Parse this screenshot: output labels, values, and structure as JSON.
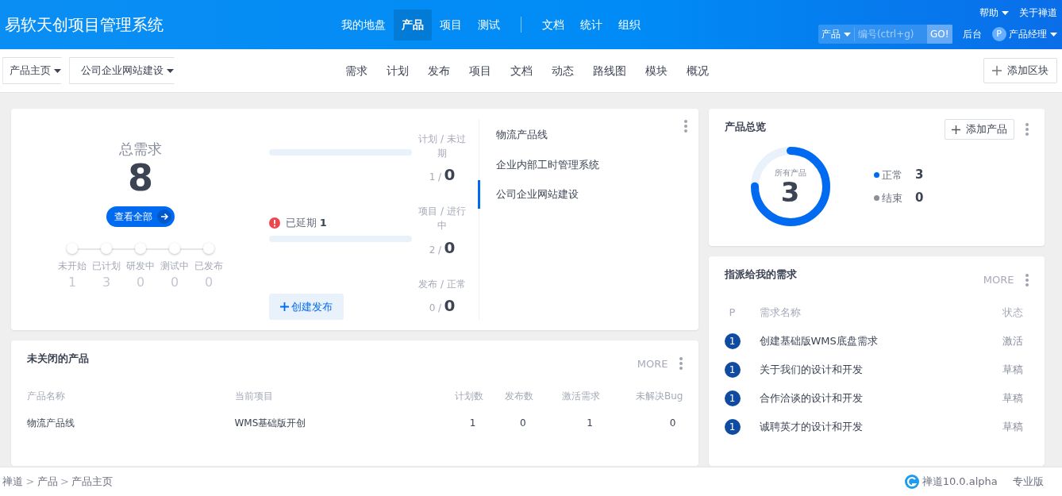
{
  "header": {
    "brand": "易软天创项目管理系统",
    "nav": [
      {
        "label": "我的地盘",
        "selected": false
      },
      {
        "label": "产品",
        "selected": true
      },
      {
        "label": "项目",
        "selected": false
      },
      {
        "label": "测试",
        "selected": false
      }
    ],
    "nav2": [
      {
        "label": "文档",
        "selected": false
      },
      {
        "label": "统计",
        "selected": false
      },
      {
        "label": "组织",
        "selected": false
      }
    ],
    "help": "帮助",
    "about": "关于禅道",
    "search_scope": "产品",
    "search": {
      "placeholder": "编号(ctrl+g)"
    },
    "go": "GO!",
    "admin": "后台",
    "avatar": "P",
    "user": "产品经理"
  },
  "subnav": {
    "crumbs": [
      "产品主页",
      "公司企业网站建设"
    ],
    "tabs": [
      {
        "label": "需求",
        "selected": false
      },
      {
        "label": "计划",
        "selected": false
      },
      {
        "label": "发布",
        "selected": false
      },
      {
        "label": "项目",
        "selected": false
      },
      {
        "label": "文档",
        "selected": false
      },
      {
        "label": "动态",
        "selected": false
      },
      {
        "label": "路线图",
        "selected": false
      },
      {
        "label": "模块",
        "selected": false
      },
      {
        "label": "概况",
        "selected": false
      }
    ],
    "add_block": "添加区块"
  },
  "stats": {
    "title": "总需求",
    "total": "8",
    "view_all": "查看全部",
    "steps": [
      {
        "label": "未开始",
        "count": "1"
      },
      {
        "label": "已计划",
        "count": "3"
      },
      {
        "label": "研发中",
        "count": "0"
      },
      {
        "label": "测试中",
        "count": "0"
      },
      {
        "label": "已发布",
        "count": "0"
      }
    ],
    "bars": [
      {
        "kind": "plain",
        "level": 0
      },
      {
        "kind": "warning",
        "label": "已延期",
        "count": "1",
        "level": 0
      }
    ],
    "create": "创建发布",
    "metrics": [
      {
        "label": "计划 / 未过期",
        "total": "1 /",
        "value": "0"
      },
      {
        "label": "项目 / 进行中",
        "total": "2 /",
        "value": "0"
      },
      {
        "label": "发布 / 正常",
        "total": "0 /",
        "value": "0"
      }
    ],
    "products": [
      {
        "label": "物流产品线",
        "selected": false
      },
      {
        "label": "企业内部工时管理系统",
        "selected": false
      },
      {
        "label": "公司企业网站建设",
        "selected": true
      }
    ]
  },
  "overview": {
    "title": "产品总览",
    "add": "添加产品",
    "ring_label": "所有产品",
    "ring_value": "3",
    "level": 0.75,
    "legend": [
      {
        "label": "正常",
        "value": "3",
        "color": "#006af1"
      },
      {
        "label": "结束",
        "value": "0",
        "color": "#8b8f96"
      }
    ]
  },
  "products_table": {
    "title": "未关闭的产品",
    "more": "MORE",
    "columns": [
      "产品名称",
      "当前项目",
      "计划数",
      "发布数",
      "激活需求",
      "未解决Bug"
    ],
    "rows": [
      [
        "物流产品线",
        "WMS基础版开创",
        "1",
        "0",
        "1",
        "0"
      ]
    ]
  },
  "assigned": {
    "title": "指派给我的需求",
    "more": "MORE",
    "columns": [
      "P",
      "需求名称",
      "状态"
    ],
    "rows": [
      {
        "pri": "1",
        "name": "创建基础版WMS底盘需求",
        "status": "激活"
      },
      {
        "pri": "1",
        "name": "关于我们的设计和开发",
        "status": "草稿"
      },
      {
        "pri": "1",
        "name": "合作洽谈的设计和开发",
        "status": "草稿"
      },
      {
        "pri": "1",
        "name": "诚聘英才的设计和开发",
        "status": "草稿"
      }
    ]
  },
  "footer": {
    "crumbs": [
      "禅道",
      "产品",
      "产品主页"
    ],
    "separator": ">",
    "version": "禅道10.0.alpha",
    "edition": "专业版"
  }
}
